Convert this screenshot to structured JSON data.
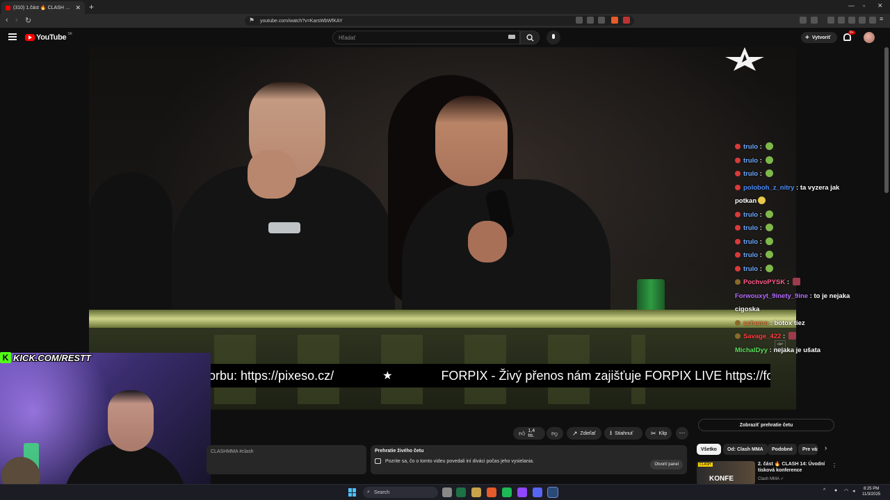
{
  "browser": {
    "tab_title": "(310) 1.část 🔥 CLASH 14: Ú",
    "tab_close": "✕",
    "new_tab": "+",
    "url": "youtube.com/watch?v=KarsWbWfKAY"
  },
  "youtube": {
    "logo_text": "YouTube",
    "country": "SK",
    "search_placeholder": "Hľadať",
    "create_label": "Vytvoriť",
    "notif_count": "9+"
  },
  "video": {
    "ticker_part1": "orbu: https://pixeso.cz/",
    "ticker_star": "★",
    "ticker_part2": "FORPIX - Živý přenos nám zajišťuje FORPIX LIVE https://fo",
    "watermark": "ole²",
    "chat_overlay": [
      {
        "user": "trulo",
        "user_color": "#6aa8ff",
        "text": "",
        "emote": "green"
      },
      {
        "user": "trulo",
        "user_color": "#6aa8ff",
        "text": "",
        "emote": "green"
      },
      {
        "user": "trulo",
        "user_color": "#6aa8ff",
        "text": "",
        "emote": "green"
      },
      {
        "user": "poloboh_z_nitry",
        "user_color": "#4a8dff",
        "text": "ta vyzera jak potkan",
        "emote": "yellow"
      },
      {
        "user": "trulo",
        "user_color": "#6aa8ff",
        "text": "",
        "emote": "green"
      },
      {
        "user": "trulo",
        "user_color": "#6aa8ff",
        "text": "",
        "emote": "green"
      },
      {
        "user": "trulo",
        "user_color": "#6aa8ff",
        "text": "",
        "emote": "green"
      },
      {
        "user": "trulo",
        "user_color": "#6aa8ff",
        "text": "",
        "emote": "green"
      },
      {
        "user": "trulo",
        "user_color": "#6aa8ff",
        "text": "",
        "emote": "green"
      },
      {
        "user": "PochvoPYSK",
        "user_color": "#ff5c8a",
        "text": "",
        "emote": "red"
      },
      {
        "user": "Forwouxyt_9inety_9ine",
        "user_color": "#b46cff",
        "text": "to je nejaka cigoska",
        "emote": ""
      },
      {
        "user": "schemo",
        "user_color": "#ff7a2e",
        "text": "botox tiez",
        "emote": ""
      },
      {
        "user": "Savage_422",
        "user_color": "#ff4040",
        "text": "",
        "emote": "red"
      },
      {
        "user": "MichalDyy",
        "user_color": "#5fe05f",
        "text": "nejaka je ušata",
        "emote": ""
      }
    ]
  },
  "cam": {
    "kick_logo": "K",
    "kick_text": "KICK.COM/RESTT"
  },
  "below": {
    "likes": "1,4 tis.",
    "share": "Zdieľať",
    "download": "Stiahnuť",
    "clip": "Klip",
    "more": "⋯",
    "desc_text": "CLASHMMA #clash",
    "chat_replay_title": "Prehratie živého četu",
    "chat_replay_desc": "Pozrite sa, čo o tomto videu povedali iní diváci počas jeho vysielania.",
    "open_panel": "Otvoriť panel",
    "show_chat": "Zobraziť prehratie četu"
  },
  "sidebar": {
    "chips": [
      "Všetko",
      "Od: Clash MMA",
      "Podobné",
      "Pre vás"
    ],
    "rec_thumb_label": "KONFE",
    "rec_title": "2. část 🔥 CLASH 14: Úvodní tisková konference",
    "rec_channel": "Clash MMA ✓"
  },
  "taskbar": {
    "search_placeholder": "Search",
    "time": "8:25 PM",
    "date": "11/3/2025"
  }
}
